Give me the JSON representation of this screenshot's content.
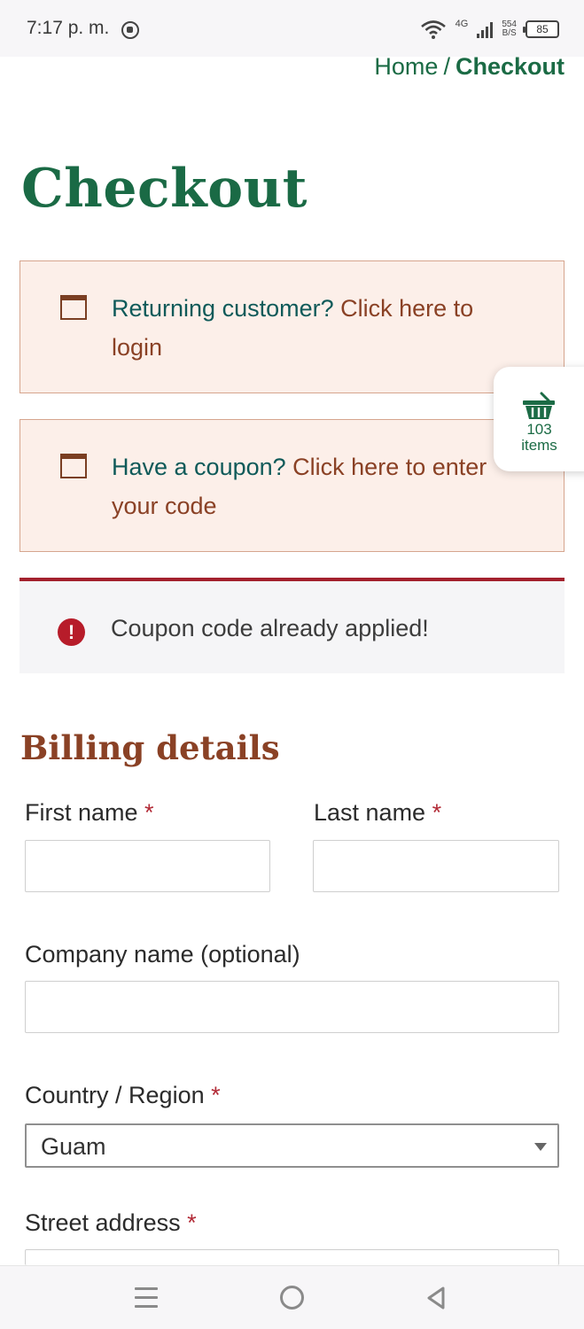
{
  "status_bar": {
    "time": "7:17 p. m.",
    "network": "4G",
    "speed_value": "554",
    "speed_unit": "B/S",
    "battery": "85"
  },
  "breadcrumb": {
    "home": "Home",
    "separator": "/",
    "current": "Checkout"
  },
  "page_title": "Checkout",
  "notices": {
    "login": {
      "prefix": "Returning customer?",
      "link": "Click here to login"
    },
    "coupon": {
      "prefix": "Have a coupon?",
      "link": "Click here to enter your code"
    }
  },
  "error": {
    "icon": "!",
    "message": "Coupon code already applied!"
  },
  "billing": {
    "title": "Billing details",
    "required_marker": "*",
    "first_name_label": "First name",
    "last_name_label": "Last name",
    "company_label": "Company name (optional)",
    "country_label": "Country / Region",
    "country_value": "Guam",
    "street_label": "Street address"
  },
  "cart": {
    "count": "103",
    "unit": "items"
  },
  "colors": {
    "brand_green": "#1a6a45",
    "link_brown": "#8a4125",
    "notice_bg": "#fcefe9",
    "error_red": "#b71c2a"
  },
  "icons": {
    "notice": "window-icon",
    "error": "exclamation-circle-icon",
    "cart": "basket-icon"
  }
}
